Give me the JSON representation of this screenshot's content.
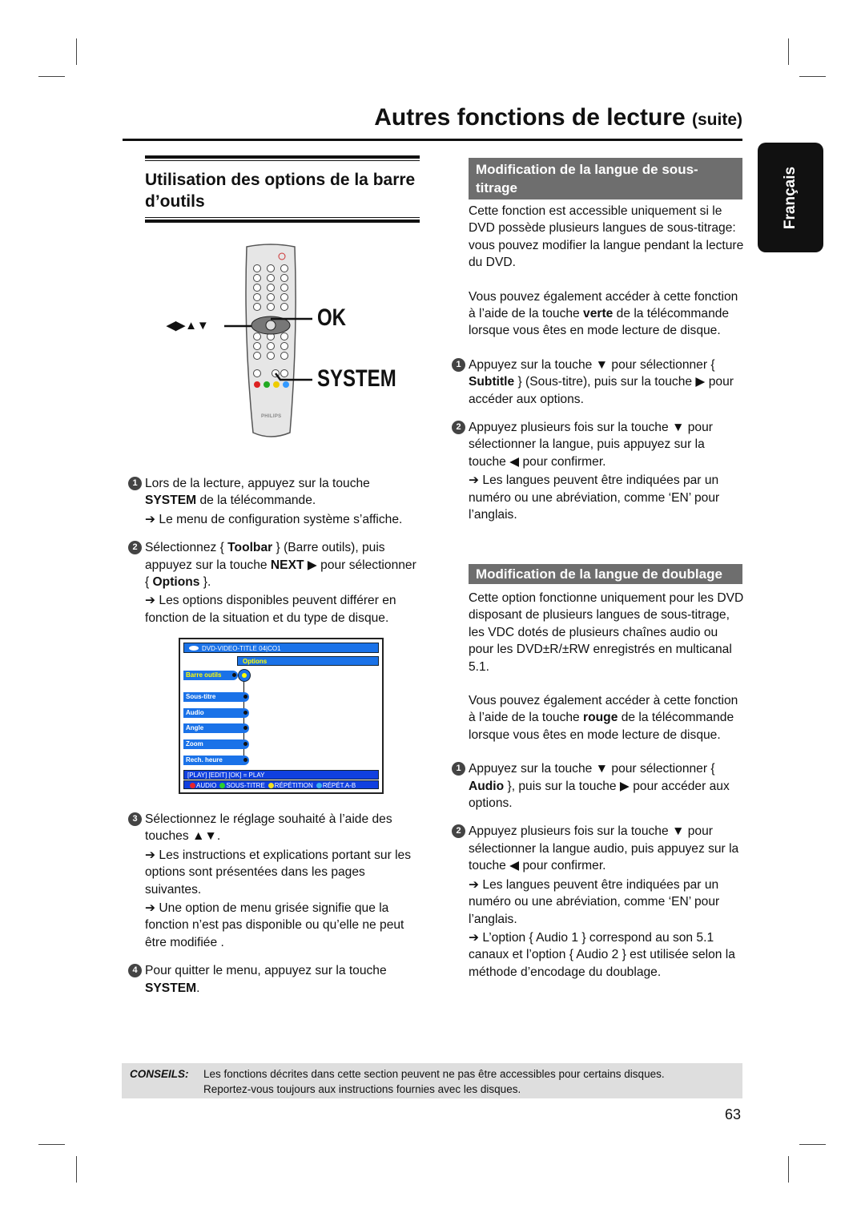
{
  "title": "Autres fonctions de lecture",
  "title_suffix": "(suite)",
  "language_tab": "Français",
  "left": {
    "heading": "Utilisation des options de la barre d’outils",
    "remote": {
      "arrows_label": "◀▶▲▼",
      "ok_label": "OK",
      "system_label": "SYSTEM",
      "brand": "PHILIPS"
    },
    "steps": [
      {
        "n": "1",
        "segs": [
          {
            "t": "Lors de la lecture, appuyez sur la touche "
          },
          {
            "t": "SYSTEM",
            "b": true
          },
          {
            "t": " de la télécommande."
          }
        ],
        "notes": [
          "➔ Le menu de configuration système s’affiche."
        ]
      },
      {
        "n": "2",
        "segs": [
          {
            "t": "Sélectionnez { "
          },
          {
            "t": "Toolbar",
            "b": true
          },
          {
            "t": " } (Barre outils), puis appuyez sur la touche "
          },
          {
            "t": "NEXT",
            "b": true
          },
          {
            "t": " ▶ pour sélectionner { "
          },
          {
            "t": "Options",
            "b": true
          },
          {
            "t": " }."
          }
        ],
        "notes": [
          "➔ Les options disponibles peuvent différer en fonction de la situation et du type de disque."
        ]
      },
      {
        "n": "3",
        "segs": [
          {
            "t": "Sélectionnez le réglage souhaité à l’aide des touches ▲▼."
          }
        ],
        "notes": [
          "➔ Les instructions et explications portant sur les options sont présentées dans les pages suivantes.",
          "➔ Une option de menu grisée signifie que la fonction n’est pas disponible ou qu’elle ne peut être modifiée ."
        ]
      },
      {
        "n": "4",
        "segs": [
          {
            "t": "Pour quitter le menu, appuyez sur la touche "
          },
          {
            "t": "SYSTEM",
            "b": true
          },
          {
            "t": "."
          }
        ],
        "notes": []
      }
    ],
    "osd": {
      "title": "DVD-VIDEO-TITLE 04|CO1",
      "options": "Options",
      "selected": "Barre outils",
      "items": [
        "Sous-titre",
        "Audio",
        "Angle",
        "Zoom",
        "Rech. heure"
      ],
      "footer": "[PLAY] [EDIT] [OK] = PLAY",
      "keys": [
        {
          "label": "AUDIO",
          "color": "#e8242a"
        },
        {
          "label": "SOUS-TITRE",
          "color": "#2bd12b"
        },
        {
          "label": "RÉPÉTITION",
          "color": "#f0e020"
        },
        {
          "label": "RÉPÉT.A-B",
          "color": "#3ab0f0"
        }
      ]
    }
  },
  "right": {
    "sections": [
      {
        "heading": "Modification de la langue de sous-titrage",
        "paras": [
          [
            {
              "t": "Cette fonction est accessible uniquement si le DVD possède plusieurs langues de sous-titrage: vous pouvez modifier la langue pendant la lecture du DVD."
            }
          ],
          [
            {
              "t": "Vous pouvez également accéder à cette fonction à l’aide de la touche "
            },
            {
              "t": "verte",
              "b": true
            },
            {
              "t": " de la télécommande lorsque vous êtes en mode lecture de disque."
            }
          ]
        ],
        "steps": [
          {
            "n": "1",
            "segs": [
              {
                "t": "Appuyez sur la touche ▼ pour sélectionner { "
              },
              {
                "t": "Subtitle",
                "b": true
              },
              {
                "t": " } (Sous-titre), puis sur la touche ▶ pour accéder aux options."
              }
            ],
            "notes": []
          },
          {
            "n": "2",
            "segs": [
              {
                "t": "Appuyez plusieurs fois sur la touche ▼ pour sélectionner la langue, puis appuyez sur la touche ◀ pour confirmer."
              }
            ],
            "notes": [
              "➔ Les langues peuvent être indiquées par un numéro ou une abréviation, comme ‘EN’ pour l’anglais."
            ]
          }
        ]
      },
      {
        "heading": "Modification de la langue de doublage",
        "paras": [
          [
            {
              "t": "Cette option fonctionne uniquement pour les DVD disposant de plusieurs langues de sous-titrage, les VDC dotés de plusieurs chaînes audio ou pour les DVD±R/±RW enregistrés en multicanal 5.1."
            }
          ],
          [
            {
              "t": "Vous pouvez également accéder à cette fonction à l’aide de la touche "
            },
            {
              "t": "rouge",
              "b": true
            },
            {
              "t": " de la télécommande lorsque vous êtes en mode lecture de disque."
            }
          ]
        ],
        "steps": [
          {
            "n": "1",
            "segs": [
              {
                "t": "Appuyez sur la touche ▼ pour sélectionner { "
              },
              {
                "t": "Audio",
                "b": true
              },
              {
                "t": " }, puis sur la touche ▶ pour accéder aux options."
              }
            ],
            "notes": []
          },
          {
            "n": "2",
            "segs": [
              {
                "t": "Appuyez plusieurs fois sur la touche ▼ pour sélectionner la langue audio, puis appuyez sur la touche ◀ pour confirmer."
              }
            ],
            "notes": [
              "➔ Les langues peuvent être indiquées par un numéro ou une abréviation, comme ‘EN’ pour l’anglais.",
              "➔ L’option { Audio 1 } correspond au son 5.1 canaux et l’option { Audio 2 } est utilisée selon la méthode d’encodage du doublage."
            ]
          }
        ]
      }
    ]
  },
  "tip": {
    "label": "CONSEILS:",
    "lines": [
      "Les fonctions décrites dans cette section peuvent ne pas être accessibles pour certains disques.",
      "Reportez-vous toujours aux instructions fournies avec les disques."
    ]
  },
  "page_number": "63"
}
